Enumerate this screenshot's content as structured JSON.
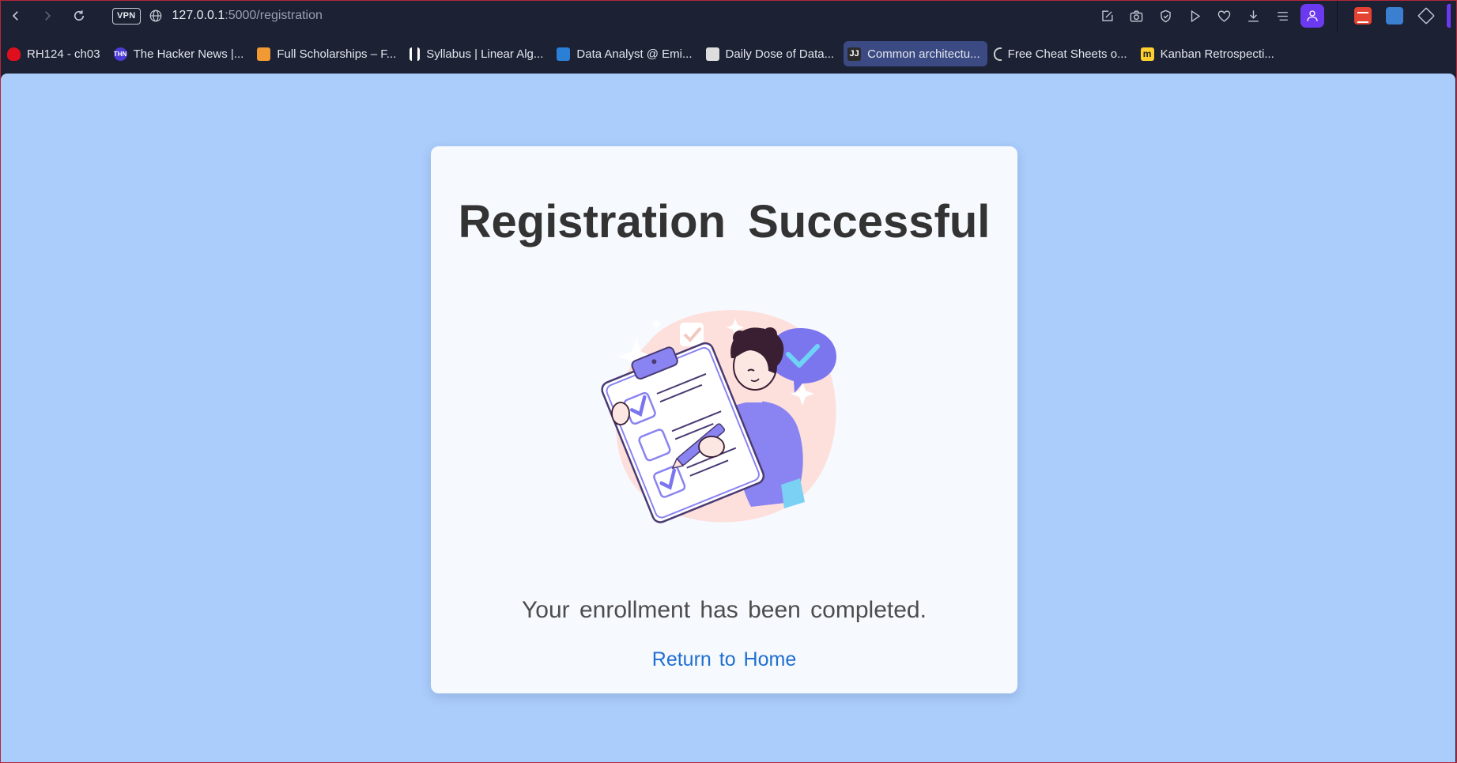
{
  "browser": {
    "vpn_label": "VPN",
    "url_host": "127.0.0.1",
    "url_path": ":5000/registration"
  },
  "bookmarks": [
    {
      "label": "RH124 - ch03",
      "icon": "redhat-icon",
      "color": "#e00f1e"
    },
    {
      "label": "The Hacker News |...",
      "icon": "thn-icon",
      "color": "#4d3bd8",
      "abbr": "THN"
    },
    {
      "label": "Full Scholarships – F...",
      "icon": "cloud-icon",
      "color": "#f19a33"
    },
    {
      "label": "Syllabus | Linear Alg...",
      "icon": "bars-icon",
      "color": "#ffffff"
    },
    {
      "label": "Data Analyst @ Emi...",
      "icon": "glass-icon",
      "color": "#2b7fd6"
    },
    {
      "label": "Daily Dose of Data...",
      "icon": "image-icon",
      "color": "#dddddd"
    },
    {
      "label": "Common architectu...",
      "icon": "jj-icon",
      "color": "#2b2b2b",
      "abbr": "JJ",
      "active": true
    },
    {
      "label": "Free Cheat Sheets o...",
      "icon": "bracket-icon",
      "color": "#cccccc"
    },
    {
      "label": "Kanban Retrospecti...",
      "icon": "miro-icon",
      "color": "#ffd02f"
    }
  ],
  "page": {
    "title": "Registration Successful",
    "message": "Your enrollment has been completed.",
    "home_link": "Return to Home"
  },
  "colors": {
    "page_background": "#abcdfb",
    "card_background": "#f6f9fe",
    "link": "#1f6fd1",
    "illustration_purple": "#7b76ee",
    "illustration_blob": "#fde0dc"
  }
}
